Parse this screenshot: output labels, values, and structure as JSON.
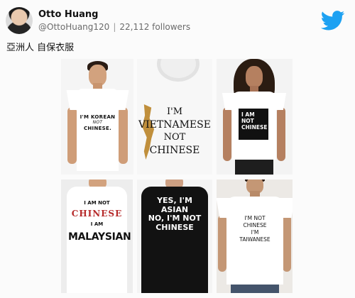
{
  "tweet": {
    "author_name": "Otto Huang",
    "verified_icon": "apple-icon",
    "handle": "@OttoHuang120",
    "separator": "|",
    "followers": "22,112 followers",
    "text": "亞洲人 自保衣服",
    "brand_icon": "twitter-bird-icon",
    "brand_color": "#1da1f2"
  },
  "images": [
    {
      "lines": [
        "I'M KOREAN",
        "NOT",
        "CHINESE."
      ]
    },
    {
      "lines": [
        "I'M",
        "VIETNAMESE",
        "NOT",
        "CHINESE"
      ]
    },
    {
      "lines": [
        "I AM",
        "NOT",
        "CHINESE"
      ]
    },
    {
      "lines": [
        "I AM NOT",
        "CHINESE",
        "I AM",
        "MALAYSIAN"
      ]
    },
    {
      "lines": [
        "YES, I'M",
        "ASIAN",
        "NO, I'M NOT",
        "CHINESE"
      ]
    },
    {
      "lines": [
        "I'M NOT",
        "CHINESE",
        "I'M",
        "TAIWANESE"
      ]
    }
  ]
}
